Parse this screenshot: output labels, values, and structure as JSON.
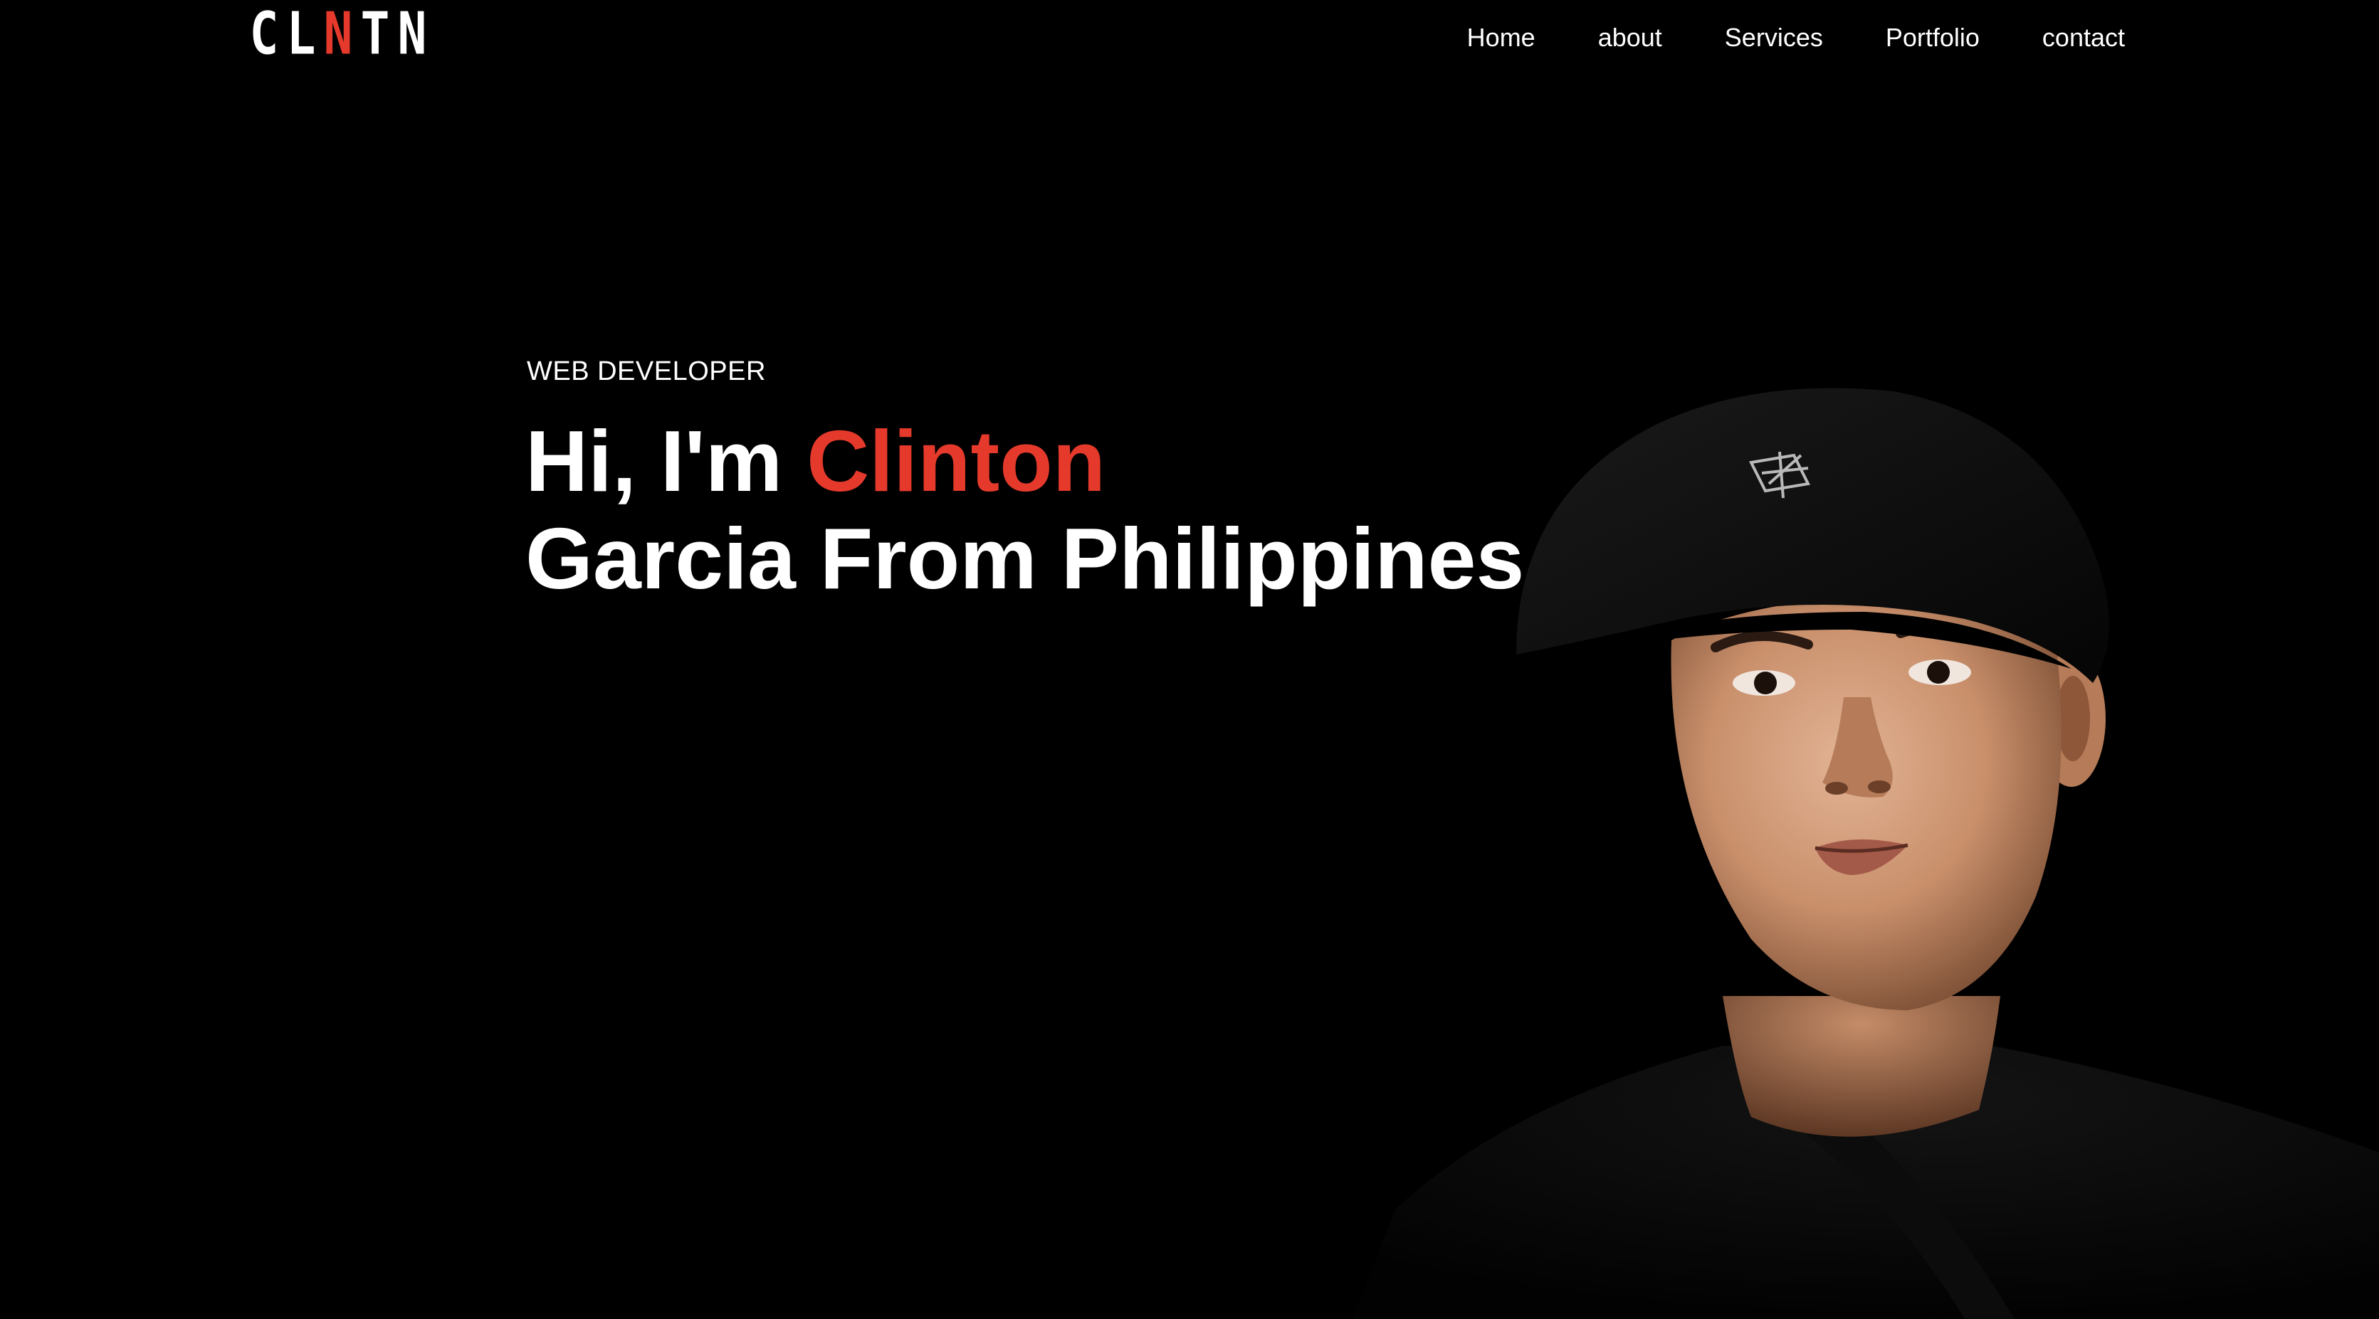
{
  "header": {
    "logo": {
      "letters": [
        "C",
        "L",
        "N",
        "T",
        "N"
      ],
      "accent_index": 2,
      "accent_color": "#e53a2b"
    },
    "nav": {
      "items": [
        {
          "label": "Home"
        },
        {
          "label": "about"
        },
        {
          "label": "Services"
        },
        {
          "label": "Portfolio"
        },
        {
          "label": "contact"
        }
      ]
    }
  },
  "hero": {
    "role": "WEB DEVELOPER",
    "title_prefix": "Hi, I'm ",
    "title_highlight": "Clinton",
    "title_line2": "Garcia From Philippines",
    "highlight_color": "#e53a2b",
    "portrait": {
      "icon": "portrait-photo"
    }
  },
  "theme": {
    "background": "#000000",
    "text": "#ffffff",
    "accent": "#e53a2b"
  }
}
